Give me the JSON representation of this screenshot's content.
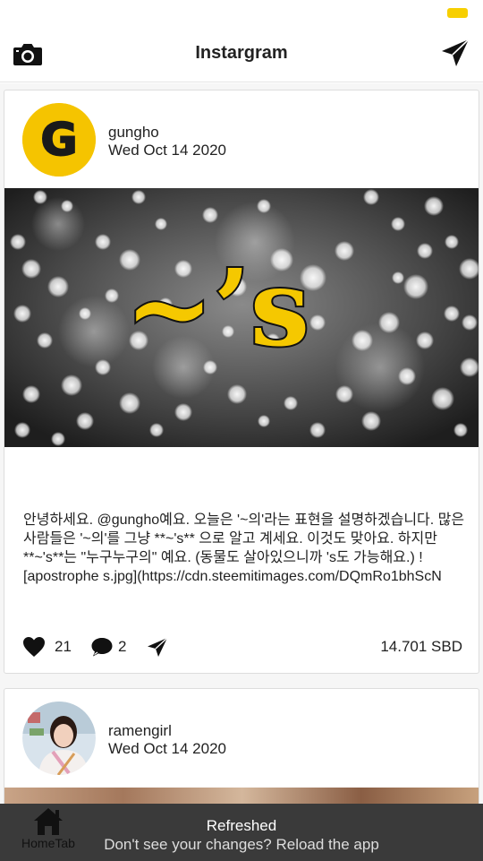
{
  "colors": {
    "accent": "#f7cf00",
    "toast_bg": "#3a3a3a",
    "text": "#222222"
  },
  "header": {
    "title": "Instargram",
    "left_icon": "camera-icon",
    "right_icon": "send-icon"
  },
  "posts": [
    {
      "author": "gungho",
      "date": "Wed Oct 14 2020",
      "avatar_letter": "G",
      "image_text": "~’s",
      "body": "안녕하세요. @gungho예요.   오늘은 '~의'라는 표현을 설명하겠습니다. 많은 사람들은 '~의'를 그냥 **~'s** 으로 알고 계세요. 이것도 맞아요.  하지만 **~'s**는 \"누구누구의\" 예요. (동물도 살아있으니까 's도 가능해요.)  ![apostrophe s.jpg](https://cdn.steemitimages.com/DQmRo1bhScN",
      "likes": "21",
      "comments": "2",
      "payout": "14.701 SBD"
    },
    {
      "author": "ramengirl",
      "date": "Wed Oct 14 2020"
    }
  ],
  "tabs": {
    "home_label": "HomeTab",
    "home_icon": "home-icon"
  },
  "toast": {
    "title": "Refreshed",
    "message": "Don't see your changes? Reload the app"
  }
}
